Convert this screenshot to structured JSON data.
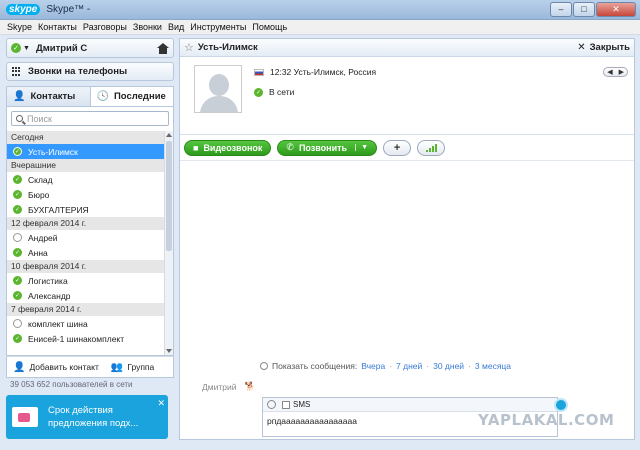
{
  "window": {
    "app": "skype",
    "title": "Skype™ - "
  },
  "menu": [
    "Skype",
    "Контакты",
    "Разговоры",
    "Звонки",
    "Вид",
    "Инструменты",
    "Помощь"
  ],
  "profile": {
    "name": "Дмитрий С"
  },
  "phones": {
    "label": "Звонки на телефоны"
  },
  "tabs": {
    "contacts": "Контакты",
    "recent": "Последние"
  },
  "search": {
    "placeholder": "Поиск"
  },
  "recent": {
    "groups": [
      {
        "label": "Сегодня",
        "items": [
          {
            "name": "Усть-Илимск",
            "online": true,
            "selected": true
          }
        ]
      },
      {
        "label": "Вчерашние",
        "items": [
          {
            "name": "Склад",
            "online": true
          },
          {
            "name": "Бюро",
            "online": true
          },
          {
            "name": "БУХГАЛТЕРИЯ",
            "online": true
          }
        ]
      },
      {
        "label": "12 февраля 2014 г.",
        "items": [
          {
            "name": "Андрей",
            "online": false
          },
          {
            "name": "Анна",
            "online": true
          }
        ]
      },
      {
        "label": "10 февраля 2014 г.",
        "items": [
          {
            "name": "Логистика",
            "online": true
          },
          {
            "name": "Александр",
            "online": true
          }
        ]
      },
      {
        "label": "7 февраля 2014 г.",
        "items": [
          {
            "name": "комплект шина",
            "online": false
          },
          {
            "name": "Енисей-1 шинакомплект",
            "online": true
          }
        ]
      }
    ]
  },
  "actions": {
    "add_contact": "Добавить контакт",
    "group": "Группа"
  },
  "online_count": "39 053 652 пользователей в сети",
  "promo": {
    "line1": "Срок действия",
    "line2": "предложения подх..."
  },
  "conversation": {
    "title": "Усть-Илимск",
    "close": "Закрыть",
    "time_location": "12:32 Усть-Илимск, Россия",
    "status": "В сети",
    "video_btn": "Видеозвонок",
    "call_btn": "Позвонить",
    "history_label": "Показать сообщения:",
    "history_links": [
      "Вчера",
      "7 дней",
      "30 дней",
      "3 месяца"
    ],
    "sender": "Дмитрий",
    "sms_label": "SMS",
    "typed_text": "рпдаааааааааааааааа"
  },
  "watermark": "YAPLAKAL.COM",
  "colors": {
    "accent": "#00aff0",
    "online": "#5bb52e",
    "selection": "#3399ff",
    "call_green": "#3aab27"
  }
}
